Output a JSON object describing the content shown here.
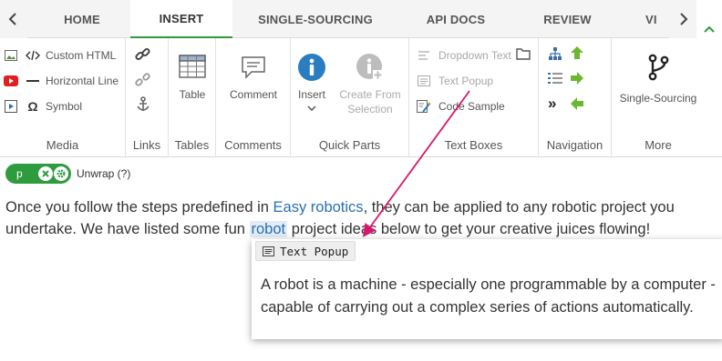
{
  "tabs": [
    {
      "label": "HOME",
      "active": false
    },
    {
      "label": "INSERT",
      "active": true
    },
    {
      "label": "SINGLE-SOURCING",
      "active": false
    },
    {
      "label": "API DOCS",
      "active": false
    },
    {
      "label": "REVIEW",
      "active": false
    },
    {
      "label": "VI",
      "active": false
    }
  ],
  "ribbon": {
    "media": {
      "label": "Media",
      "items": [
        {
          "label": "Custom HTML",
          "icon": "image-icon"
        },
        {
          "label": "Horizontal Line",
          "icon": "youtube-icon"
        },
        {
          "label": "Symbol",
          "icon": "video-icon"
        }
      ],
      "sub_icons": [
        "code-icon",
        "horizontal-line-icon",
        "omega-icon"
      ]
    },
    "links": {
      "label": "Links",
      "icons": [
        "link-icon",
        "unlink-icon",
        "anchor-icon"
      ]
    },
    "tables": {
      "label": "Tables",
      "button": "Table"
    },
    "comments": {
      "label": "Comments",
      "button": "Comment"
    },
    "quick_parts": {
      "label": "Quick Parts",
      "insert": "Insert",
      "create_line1": "Create From",
      "create_line2": "Selection"
    },
    "text_boxes": {
      "label": "Text Boxes",
      "items": [
        {
          "label": "Dropdown Text",
          "disabled": true
        },
        {
          "label": "Text Popup",
          "disabled": true
        },
        {
          "label": "Code Sample",
          "disabled": false
        }
      ]
    },
    "navigation": {
      "label": "Navigation"
    },
    "more": {
      "label": "More",
      "button": "Single-Sourcing"
    }
  },
  "tagbar": {
    "tag": "p",
    "unwrap": "Unwrap (?)"
  },
  "content": {
    "p1_before": "Once you follow the steps predefined in ",
    "p1_link": "Easy robotics",
    "p1_after": ", they can be applied to any robotic project you undertake. We have listed some fun ",
    "p1_highlight": "robot",
    "p1_end": " project ideas below to get your creative juices flowing!"
  },
  "popup": {
    "title": "Text Popup",
    "body": "A robot is a machine - especially one programmable by a computer - capable of carrying out a complex series of actions automatically."
  },
  "colors": {
    "accent": "#2e9b3e",
    "link": "#2a6fb4",
    "info_blue": "#2a7dc1",
    "pointer": "#d6186a",
    "nav_green": "#6ab82f"
  }
}
